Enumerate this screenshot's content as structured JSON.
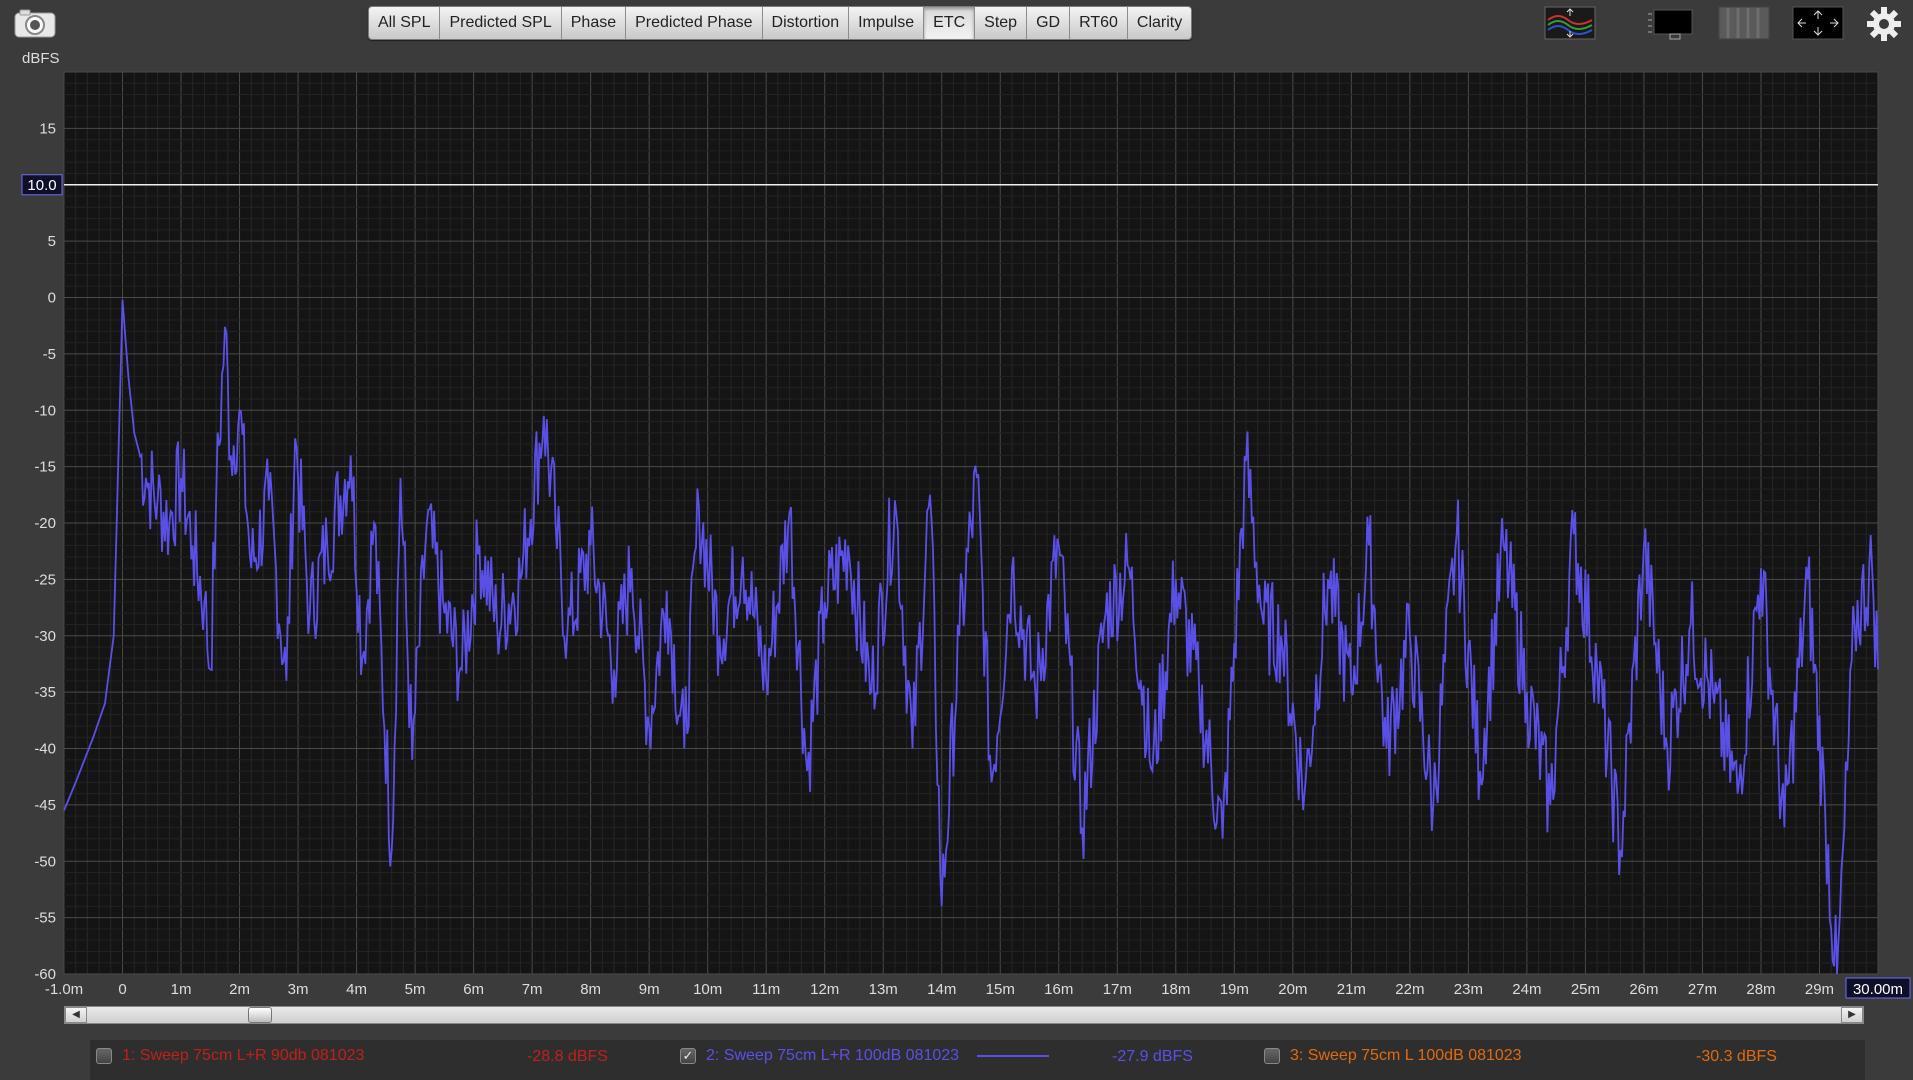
{
  "toolbar": {
    "tabs": [
      {
        "label": "All SPL"
      },
      {
        "label": "Predicted SPL"
      },
      {
        "label": "Phase"
      },
      {
        "label": "Predicted Phase"
      },
      {
        "label": "Distortion"
      },
      {
        "label": "Impulse"
      },
      {
        "label": "ETC"
      },
      {
        "label": "Step"
      },
      {
        "label": "GD"
      },
      {
        "label": "RT60"
      },
      {
        "label": "Clarity"
      }
    ],
    "active_tab": "ETC"
  },
  "plot": {
    "y_unit": "dBFS",
    "cursor_value": "10.0",
    "x_end_value": "30.00m",
    "colors": {
      "background": "#141414",
      "grid": "#3a3a3a",
      "trace": "#5a50e8",
      "cursor_line": "#f0f0f0"
    }
  },
  "chart_data": {
    "type": "line",
    "ylabel": "dBFS",
    "ylim": [
      -60,
      20
    ],
    "xlim": [
      -1.0,
      30.0
    ],
    "y_ticks": [
      "15",
      "10",
      "5",
      "0",
      "-5",
      "-10",
      "-15",
      "-20",
      "-25",
      "-30",
      "-35",
      "-40",
      "-45",
      "-50",
      "-55",
      "-60"
    ],
    "x_ticks": [
      "-1.0m",
      "0",
      "1m",
      "2m",
      "3m",
      "4m",
      "5m",
      "6m",
      "7m",
      "8m",
      "9m",
      "10m",
      "11m",
      "12m",
      "13m",
      "14m",
      "15m",
      "16m",
      "17m",
      "18m",
      "19m",
      "20m",
      "21m",
      "22m",
      "23m",
      "24m",
      "25m",
      "26m",
      "27m",
      "28m",
      "29m"
    ],
    "series": [
      {
        "name": "2: Sweep 75cm L+R 100dB 081023",
        "color": "#5a50e8",
        "x": [
          -1.0,
          -0.8,
          -0.5,
          -0.3,
          -0.15,
          0,
          0.1,
          0.2,
          0.4,
          0.6,
          0.8,
          1.0,
          1.2,
          1.4,
          1.5,
          1.6,
          1.75,
          1.85,
          2.0,
          2.2,
          2.5,
          2.8,
          2.95,
          3.2,
          3.5,
          3.9,
          4.1,
          4.3,
          4.6,
          4.75,
          4.95,
          5.2,
          5.5,
          5.8,
          6.1,
          6.4,
          6.8,
          7.2,
          7.4,
          7.6,
          8.0,
          8.4,
          8.7,
          9.0,
          9.3,
          9.6,
          9.85,
          10.2,
          10.6,
          11.0,
          11.4,
          11.7,
          12.0,
          12.4,
          12.8,
          13.2,
          13.5,
          13.8,
          14.0,
          14.3,
          14.6,
          14.85,
          15.2,
          15.6,
          16.0,
          16.4,
          16.8,
          17.2,
          17.6,
          18.0,
          18.4,
          18.8,
          19.2,
          19.5,
          19.8,
          20.2,
          20.6,
          21.0,
          21.3,
          21.6,
          22.0,
          22.4,
          22.8,
          23.2,
          23.6,
          24.0,
          24.4,
          24.8,
          25.2,
          25.6,
          26.0,
          26.4,
          26.8,
          27.2,
          27.6,
          28.0,
          28.4,
          28.8,
          29.1,
          29.3,
          29.6,
          29.9,
          30.0
        ],
        "y": [
          -45.5,
          -43,
          -39,
          -36,
          -30,
          -0.2,
          -7,
          -12,
          -16,
          -18,
          -20,
          -16,
          -22,
          -27,
          -33,
          -18,
          -2.6,
          -14,
          -10,
          -24,
          -18,
          -34,
          -12.5,
          -28,
          -22,
          -14,
          -32,
          -20,
          -49,
          -16,
          -41,
          -20,
          -28,
          -33,
          -22,
          -29,
          -25,
          -10.5,
          -20,
          -30,
          -22,
          -33,
          -24,
          -38,
          -26,
          -40,
          -18.5,
          -30,
          -23,
          -34,
          -19,
          -42,
          -27,
          -22,
          -35,
          -18,
          -40,
          -17.5,
          -54,
          -30,
          -16,
          -43,
          -24,
          -35,
          -22,
          -47,
          -28,
          -24,
          -42,
          -25,
          -35,
          -48,
          -14.5,
          -29,
          -30,
          -44,
          -25,
          -35,
          -22,
          -40,
          -30,
          -45,
          -21,
          -42,
          -22,
          -35,
          -45,
          -21,
          -33,
          -49,
          -22,
          -40,
          -29,
          -36,
          -44,
          -24,
          -47,
          -25,
          -46,
          -61,
          -29,
          -24,
          -33
        ]
      }
    ]
  },
  "legend": {
    "items": [
      {
        "label": "1: Sweep 75cm L+R 90db 081023",
        "value": "-28.8 dBFS",
        "checked": false,
        "color": "#c0201c"
      },
      {
        "label": "2: Sweep 75cm L+R 100dB 081023",
        "value": "-27.9 dBFS",
        "checked": true,
        "color": "#5a50e8"
      },
      {
        "label": "3: Sweep 75cm L 100dB 081023",
        "value": "-30.3 dBFS",
        "checked": false,
        "color": "#e06a12"
      }
    ]
  },
  "icons": [
    "camera-icon",
    "waterfall-controls-icon",
    "overlay-icon",
    "panel-icon",
    "expand-icon",
    "settings-gear-icon"
  ]
}
